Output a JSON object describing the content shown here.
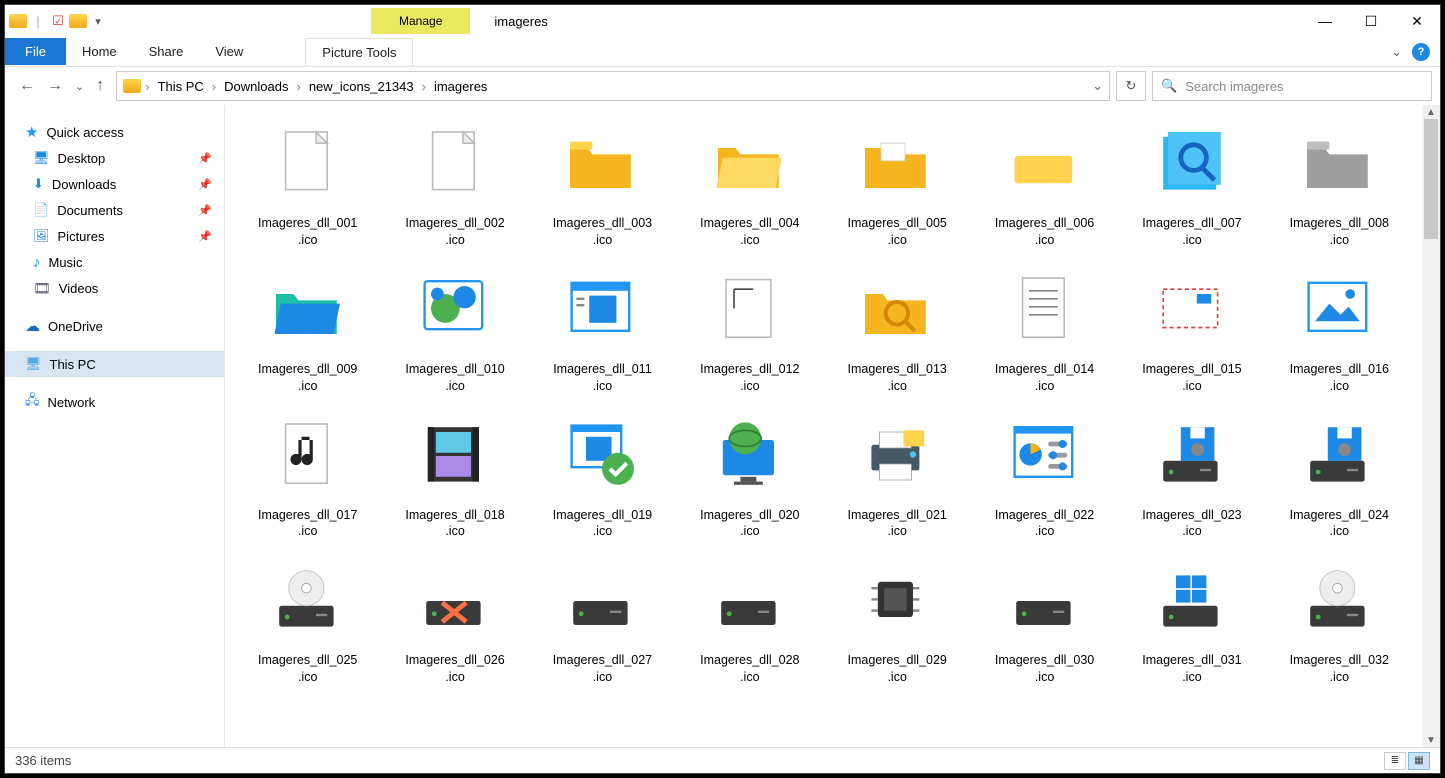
{
  "title": "imageres",
  "manage_label": "Manage",
  "ribbon": {
    "file": "File",
    "tabs": [
      "Home",
      "Share",
      "View"
    ],
    "context_tab": "Picture Tools"
  },
  "breadcrumb": [
    "This PC",
    "Downloads",
    "new_icons_21343",
    "imageres"
  ],
  "search": {
    "placeholder": "Search imageres"
  },
  "nav": {
    "quick_access": "Quick access",
    "pinned": [
      {
        "label": "Desktop",
        "pinned": true
      },
      {
        "label": "Downloads",
        "pinned": true
      },
      {
        "label": "Documents",
        "pinned": true
      },
      {
        "label": "Pictures",
        "pinned": true
      },
      {
        "label": "Music",
        "pinned": false
      },
      {
        "label": "Videos",
        "pinned": false
      }
    ],
    "onedrive": "OneDrive",
    "thispc": "This PC",
    "network": "Network"
  },
  "files": [
    {
      "name": "Imageres_dll_001.ico",
      "icon": "blank-file"
    },
    {
      "name": "Imageres_dll_002.ico",
      "icon": "blank-file"
    },
    {
      "name": "Imageres_dll_003.ico",
      "icon": "folder-closed"
    },
    {
      "name": "Imageres_dll_004.ico",
      "icon": "folder-open"
    },
    {
      "name": "Imageres_dll_005.ico",
      "icon": "folder-docs"
    },
    {
      "name": "Imageres_dll_006.ico",
      "icon": "folder-flat"
    },
    {
      "name": "Imageres_dll_007.ico",
      "icon": "folder-search"
    },
    {
      "name": "Imageres_dll_008.ico",
      "icon": "folder-gray"
    },
    {
      "name": "Imageres_dll_009.ico",
      "icon": "folder-teal"
    },
    {
      "name": "Imageres_dll_010.ico",
      "icon": "network-globe"
    },
    {
      "name": "Imageres_dll_011.ico",
      "icon": "app-window"
    },
    {
      "name": "Imageres_dll_012.ico",
      "icon": "doc-blank"
    },
    {
      "name": "Imageres_dll_013.ico",
      "icon": "folder-search-y"
    },
    {
      "name": "Imageres_dll_014.ico",
      "icon": "text-doc"
    },
    {
      "name": "Imageres_dll_015.ico",
      "icon": "mail"
    },
    {
      "name": "Imageres_dll_016.ico",
      "icon": "picture"
    },
    {
      "name": "Imageres_dll_017.ico",
      "icon": "music-file"
    },
    {
      "name": "Imageres_dll_018.ico",
      "icon": "video-file"
    },
    {
      "name": "Imageres_dll_019.ico",
      "icon": "app-checked"
    },
    {
      "name": "Imageres_dll_020.ico",
      "icon": "monitor-globe"
    },
    {
      "name": "Imageres_dll_021.ico",
      "icon": "printer"
    },
    {
      "name": "Imageres_dll_022.ico",
      "icon": "control-panel"
    },
    {
      "name": "Imageres_dll_023.ico",
      "icon": "floppy-drive"
    },
    {
      "name": "Imageres_dll_024.ico",
      "icon": "floppy-drive"
    },
    {
      "name": "Imageres_dll_025.ico",
      "icon": "cd-drive"
    },
    {
      "name": "Imageres_dll_026.ico",
      "icon": "drive-err"
    },
    {
      "name": "Imageres_dll_027.ico",
      "icon": "drive"
    },
    {
      "name": "Imageres_dll_028.ico",
      "icon": "drive"
    },
    {
      "name": "Imageres_dll_029.ico",
      "icon": "chip"
    },
    {
      "name": "Imageres_dll_030.ico",
      "icon": "drive"
    },
    {
      "name": "Imageres_dll_031.ico",
      "icon": "windows-drive"
    },
    {
      "name": "Imageres_dll_032.ico",
      "icon": "cd-drive"
    }
  ],
  "status": {
    "count": "336 items"
  }
}
